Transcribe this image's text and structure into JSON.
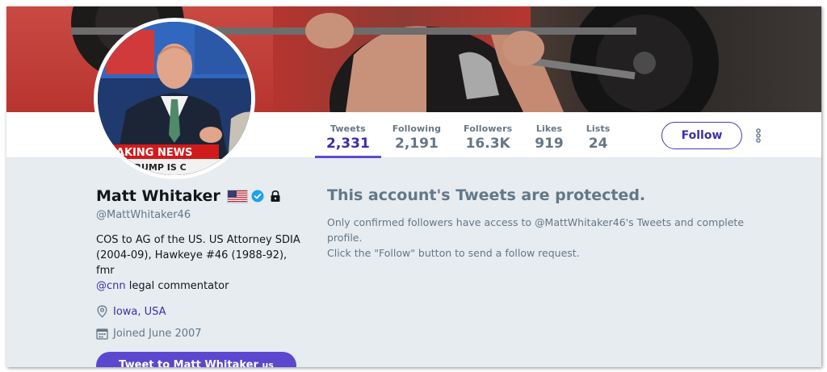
{
  "profile": {
    "name": "Matt Whitaker",
    "handle": "@MattWhitaker46",
    "bio_text": "COS to AG of the US. US Attorney SDIA (2004-09), Hawkeye #46 (1988-92), fmr",
    "bio_mention": "@cnn",
    "bio_tail": " legal commentator",
    "location": "Iowa, USA",
    "joined": "Joined June 2007",
    "tweet_to_label": "Tweet to Matt Whitaker",
    "tweet_to_emoji": "us",
    "avatar_caption": "REAKING NEWS",
    "avatar_subcaption": "TRUMP IS C"
  },
  "stats": [
    {
      "label": "Tweets",
      "value": "2,331"
    },
    {
      "label": "Following",
      "value": "2,191"
    },
    {
      "label": "Followers",
      "value": "16.3K"
    },
    {
      "label": "Likes",
      "value": "919"
    },
    {
      "label": "Lists",
      "value": "24"
    }
  ],
  "nav": {
    "follow_label": "Follow"
  },
  "protected": {
    "title": "This account's Tweets are protected.",
    "message_1": "Only confirmed followers have access to @MattWhitaker46's Tweets and complete profile.",
    "message_2": "Click the \"Follow\" button to send a follow request."
  },
  "colors": {
    "accent": "#5b48cf",
    "link": "#3b2fa8",
    "muted": "#657786",
    "page_bg": "#e6ecf0"
  },
  "icons": {
    "verified": "verified-badge-icon",
    "lock": "lock-icon",
    "location": "location-pin-icon",
    "calendar": "calendar-icon",
    "more": "more-vertical-icon",
    "flag": "us-flag-icon"
  }
}
